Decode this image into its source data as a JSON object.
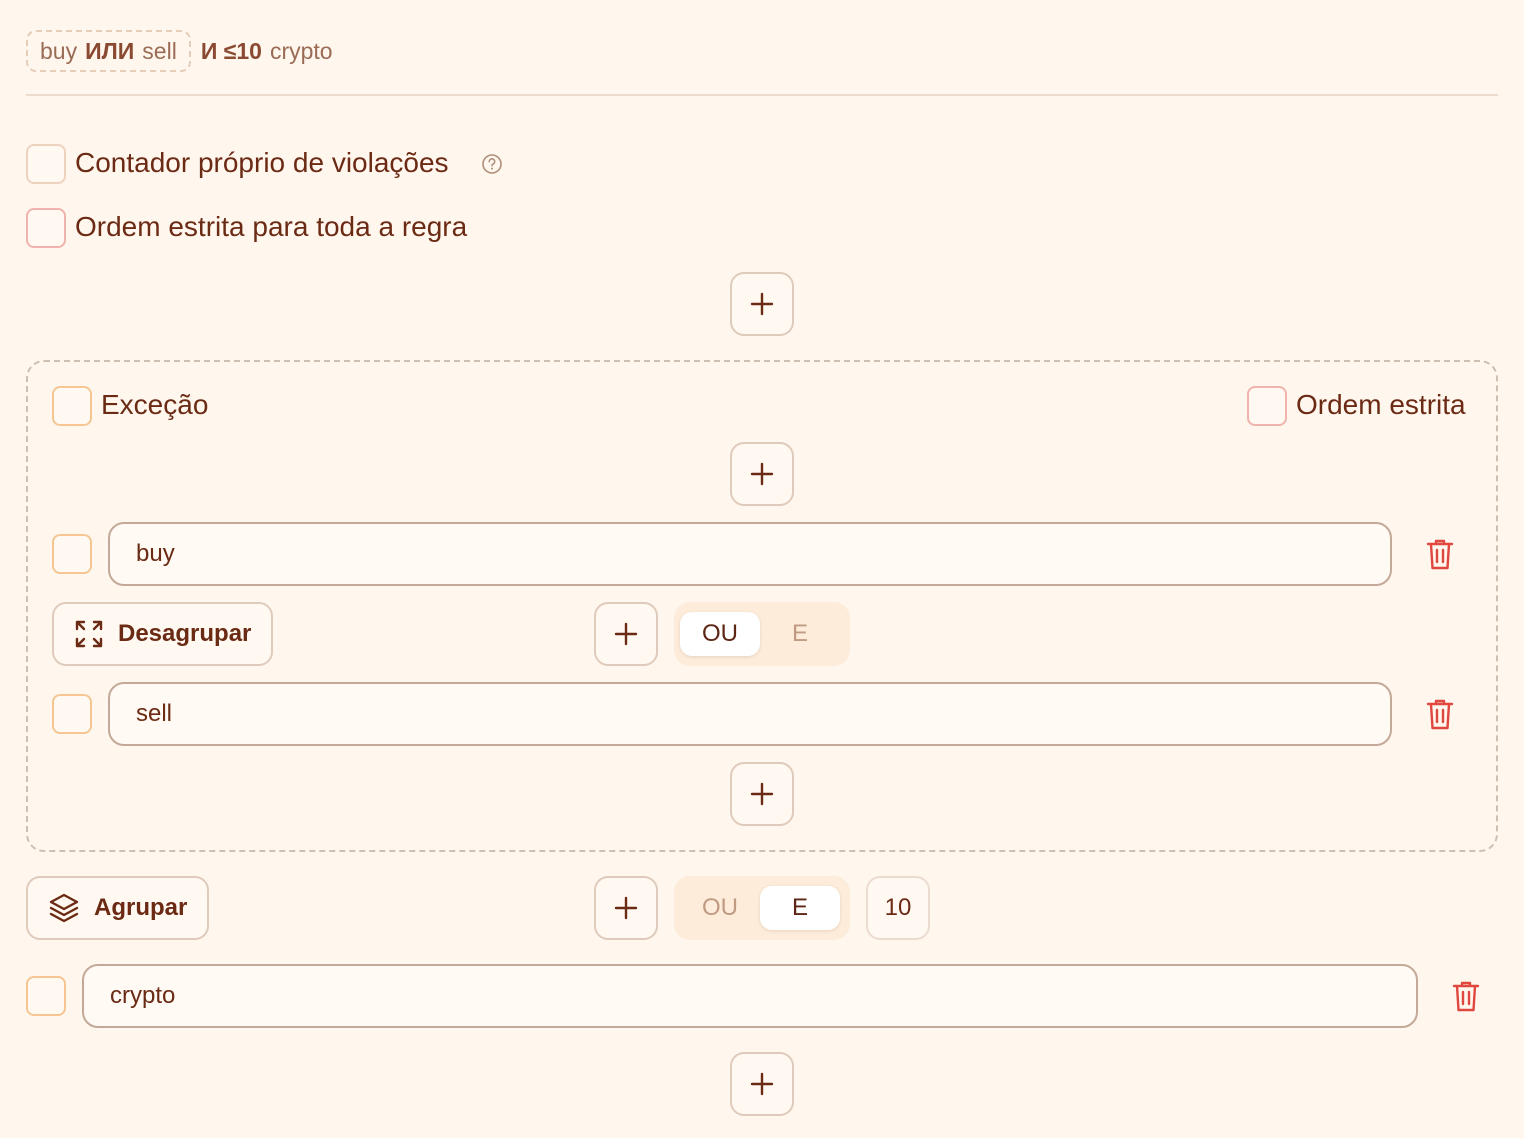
{
  "summary": {
    "chip_term1": "buy",
    "chip_op": "ИЛИ",
    "chip_term2": "sell",
    "rest_op": "И ≤10",
    "rest_term": "crypto"
  },
  "options": {
    "own_counter_label": "Contador próprio de violações",
    "strict_order_rule_label": "Ordem estrita para toda a regra"
  },
  "group": {
    "exception_label": "Exceção",
    "strict_order_label": "Ordem estrita",
    "terms": [
      {
        "value": "buy"
      },
      {
        "value": "sell"
      }
    ],
    "ungroup_label": "Desagrupar",
    "operator": {
      "options": [
        "OU",
        "E"
      ],
      "selected": "OU"
    }
  },
  "outer": {
    "group_label": "Agrupar",
    "operator": {
      "options": [
        "OU",
        "E"
      ],
      "selected": "E"
    },
    "distance": "10",
    "term": {
      "value": "crypto"
    }
  },
  "colors": {
    "background": "#fff7ee",
    "text": "#6b2a14",
    "delete": "#e0473f"
  },
  "icons": {
    "plus": "plus-icon",
    "trash": "trash-icon",
    "ungroup": "expand-arrows-icon",
    "group": "layers-icon",
    "help": "help-circle-icon"
  }
}
